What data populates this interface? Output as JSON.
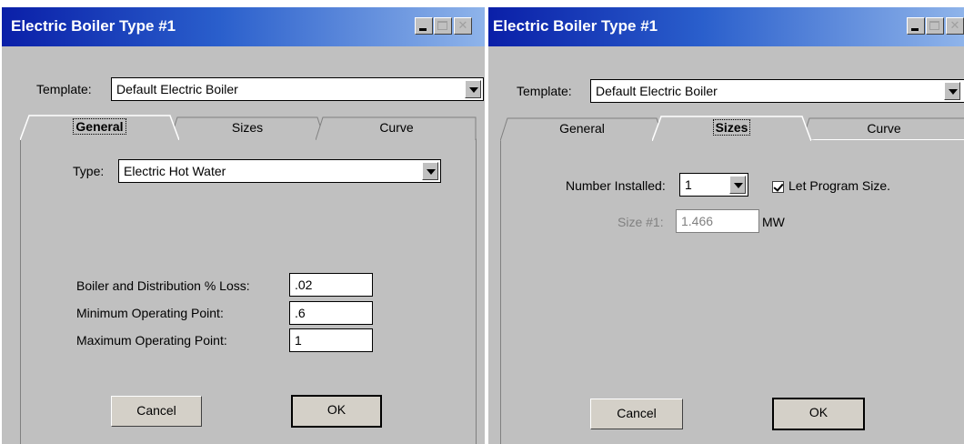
{
  "left": {
    "title": "Electric Boiler Type #1",
    "template_label": "Template:",
    "template_value": "Default Electric Boiler",
    "tabs": [
      "General",
      "Sizes",
      "Curve"
    ],
    "active_tab": "General",
    "type_label": "Type:",
    "type_value": "Electric Hot Water",
    "fields": [
      {
        "label": "Boiler and Distribution % Loss:",
        "value": ".02"
      },
      {
        "label": "Minimum Operating Point:",
        "value": ".6"
      },
      {
        "label": "Maximum Operating Point:",
        "value": "1"
      }
    ],
    "cancel": "Cancel",
    "ok": "OK"
  },
  "right": {
    "title": "Electric Boiler Type #1",
    "template_label": "Template:",
    "template_value": "Default Electric Boiler",
    "tabs": [
      "General",
      "Sizes",
      "Curve"
    ],
    "active_tab": "Sizes",
    "number_installed_label": "Number Installed:",
    "number_installed_value": "1",
    "let_program_size_label": "Let Program Size.",
    "let_program_size_checked": true,
    "size1_label": "Size #1:",
    "size1_value": "1.466",
    "size1_unit": "MW",
    "cancel": "Cancel",
    "ok": "OK"
  }
}
